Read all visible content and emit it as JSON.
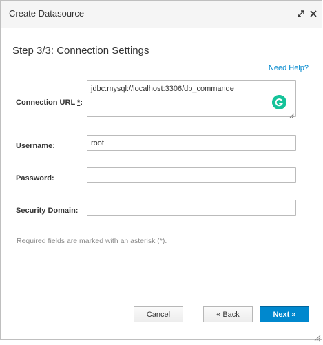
{
  "dialog": {
    "title": "Create Datasource",
    "step_title": "Step 3/3: Connection Settings",
    "help_link": "Need Help?"
  },
  "form": {
    "connection_url": {
      "label": "Connection URL",
      "required_mark": "*",
      "label_suffix": ":",
      "value": "jdbc:mysql://localhost:3306/db_commande"
    },
    "username": {
      "label": "Username:",
      "value": "root"
    },
    "password": {
      "label": "Password:",
      "value": ""
    },
    "security_domain": {
      "label": "Security Domain:",
      "value": ""
    }
  },
  "note": {
    "text": "Required fields are marked with an asterisk (",
    "asterisk": "*",
    "text_end": ")."
  },
  "buttons": {
    "cancel": "Cancel",
    "back": "« Back",
    "next": "Next »"
  },
  "icons": {
    "maximize": "expand-arrows-icon",
    "close": "close-icon",
    "grammarly": "grammarly-icon",
    "grammarly_color": "#15c39a"
  },
  "colors": {
    "accent": "#0088ce",
    "titlebar": "#f5f5f5"
  }
}
